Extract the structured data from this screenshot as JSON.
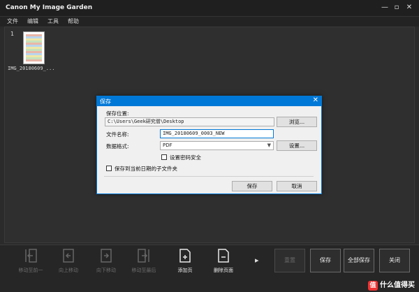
{
  "app": {
    "title": "Canon My Image Garden"
  },
  "window_controls": {
    "minimize": "—",
    "maximize": "▫",
    "close": "✕"
  },
  "menu": [
    "文件",
    "编辑",
    "工具",
    "帮助"
  ],
  "workspace": {
    "page_number": "1",
    "thumbnail_label": "IMG_20180609_..."
  },
  "dialog": {
    "title": "保存",
    "close": "✕",
    "location_label": "保存位置:",
    "location_value": "C:\\Users\\Geek研究僧\\Desktop",
    "browse_button": "浏览...",
    "filename_label": "文件名称:",
    "filename_value": "IMG_20180609_0003_NEW",
    "format_label": "数据格式:",
    "format_value": "PDF",
    "settings_button": "设置...",
    "password_checkbox": "设置密码安全",
    "subfolder_checkbox": "保存到当前日期的子文件夹",
    "save_button": "保存",
    "cancel_button": "取消"
  },
  "toolbar": {
    "tools": [
      {
        "label": "移动至前一",
        "enabled": false,
        "icon": "move-to-first-icon"
      },
      {
        "label": "向上移动",
        "enabled": false,
        "icon": "move-up-icon"
      },
      {
        "label": "向下移动",
        "enabled": false,
        "icon": "move-down-icon"
      },
      {
        "label": "移动至最后",
        "enabled": false,
        "icon": "move-to-last-icon"
      },
      {
        "label": "添加页",
        "enabled": true,
        "icon": "add-page-icon"
      },
      {
        "label": "删除页面",
        "enabled": true,
        "icon": "delete-page-icon"
      }
    ],
    "reset_button": "重置",
    "save_button": "保存",
    "save_all_button": "全部保存",
    "close_button": "关闭"
  },
  "watermark": {
    "badge": "值",
    "text": "什么值得买"
  },
  "colors": {
    "accent": "#0078d7",
    "background": "#2b2b2b",
    "dialog_bg": "#f0f0f0"
  }
}
